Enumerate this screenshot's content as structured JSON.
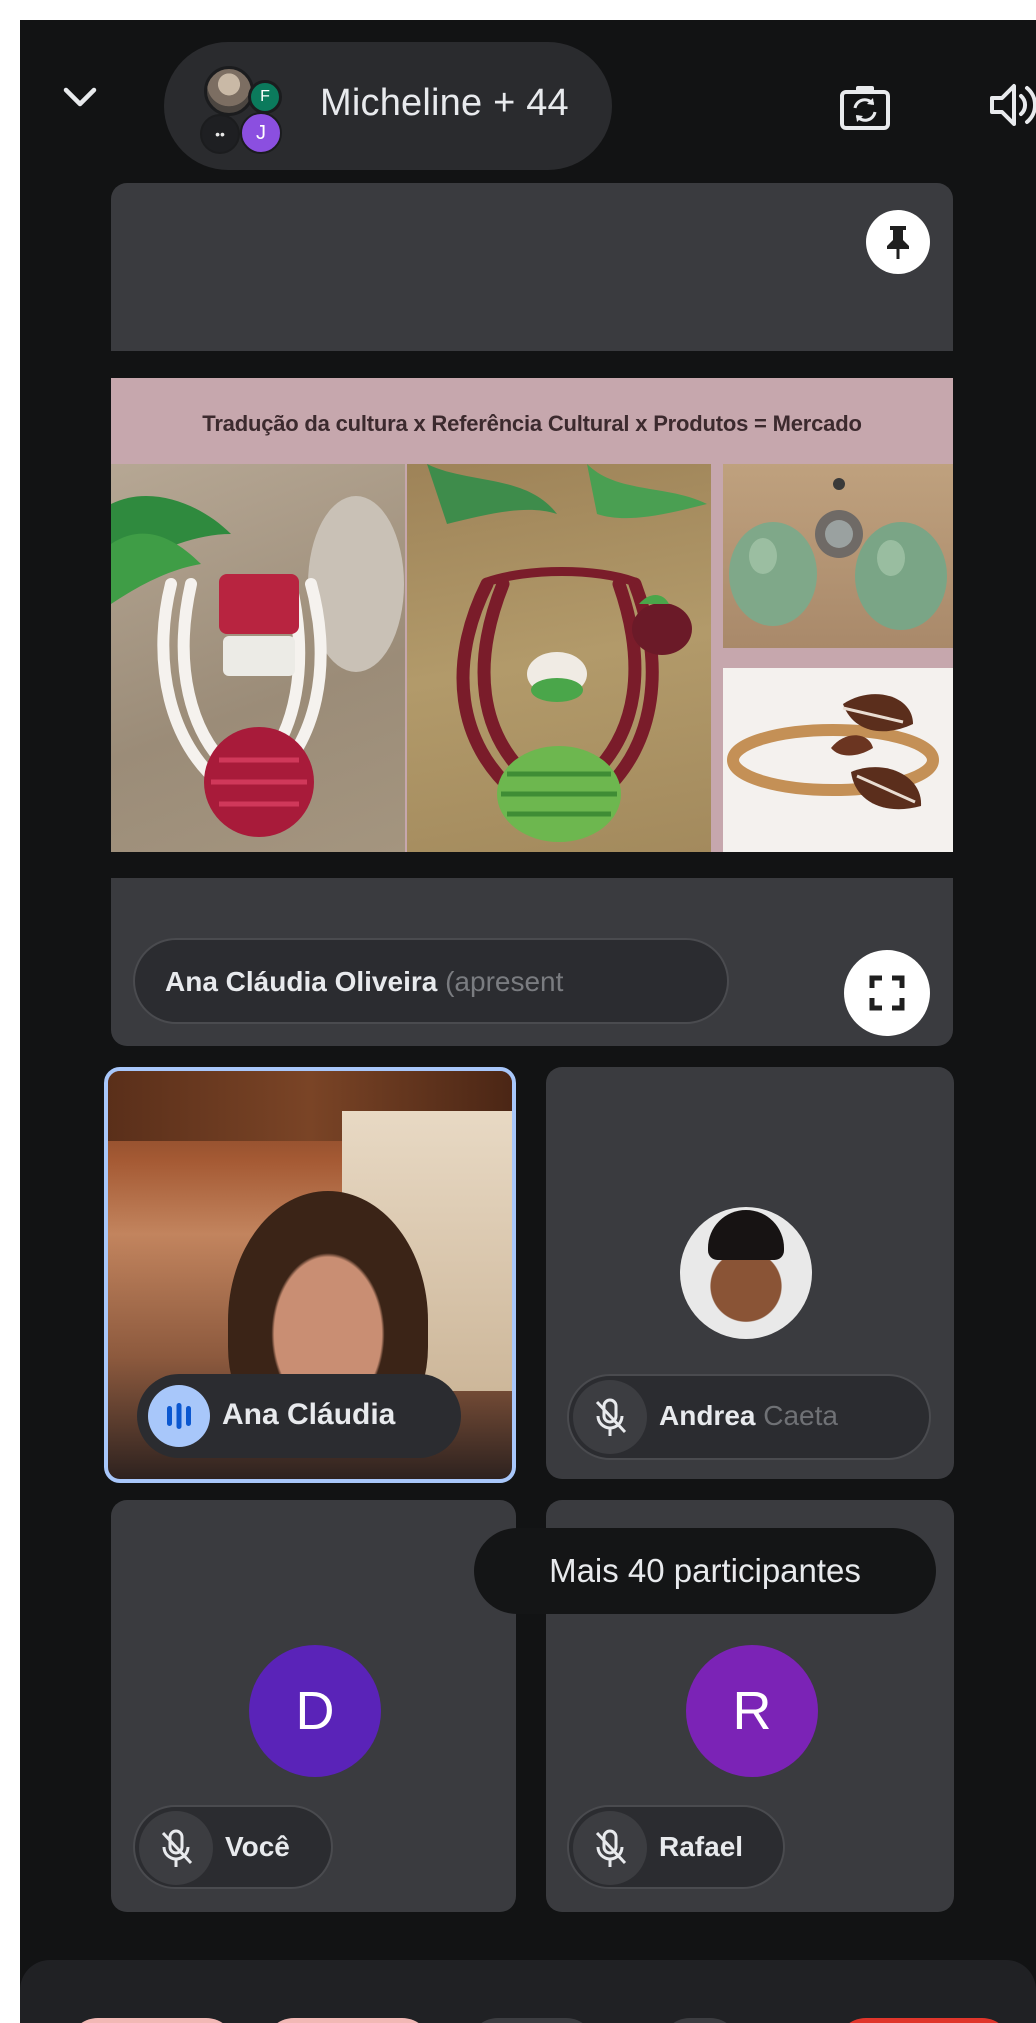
{
  "header": {
    "title": "Micheline + 44",
    "avatar_letters": {
      "f": "F",
      "j": "J",
      "multi": "••"
    }
  },
  "presentation": {
    "slide_title": "Tradução da cultura x Referência Cultural x Produtos = Mercado",
    "presenter_name": "Ana Cláudia Oliveira",
    "presenter_suffix": "(apresent"
  },
  "participants": [
    {
      "name": "Ana Cláudia",
      "speaking": true
    },
    {
      "name_bold": "Andrea",
      "name_faded": "Caeta",
      "muted": true
    },
    {
      "name": "Você",
      "avatar_letter": "D",
      "muted": true,
      "avatar_color": "#5a23b8"
    },
    {
      "name": "Rafael",
      "avatar_letter": "R",
      "muted": true,
      "avatar_color": "#7b23b6"
    }
  ],
  "more_participants_label": "Mais 40 participantes",
  "colors": {
    "background": "#121314",
    "tile": "#3a3b3f",
    "speaking_outline": "#a8c7fa",
    "end_call": "#e0352b",
    "bottom_button_pink": "#f2b8b5"
  },
  "icons": [
    "chevron-down-icon",
    "camera-switch-icon",
    "speaker-icon",
    "pin-icon",
    "fullscreen-icon",
    "audio-level-icon",
    "mic-off-icon"
  ]
}
